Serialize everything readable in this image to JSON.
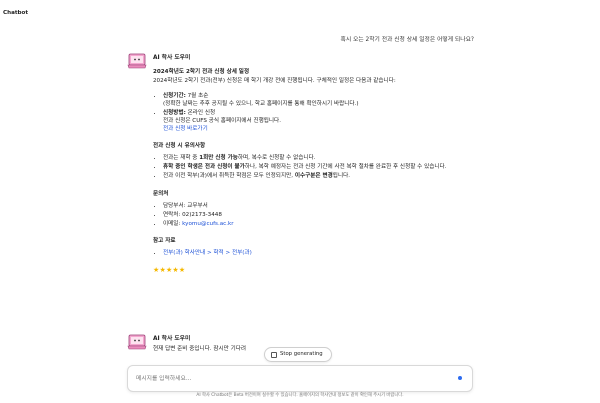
{
  "app": {
    "title": "Chatbot"
  },
  "user_message": "혹시 오는 2학기 전과 신청 상세 일정은 어떻게 되나요?",
  "bot_name": "AI 학사 도우미",
  "answer": {
    "heading": "2024학년도 2학기 전과 신청 상세 일정",
    "intro": "2024학년도 2학기 전과(전부) 신청은 매 학기 개강 전에 진행됩니다. 구체적인 일정은 다음과 같습니다:",
    "period_label": "신청기간:",
    "period_value": "7월 초순",
    "period_note": "(정확한 날짜는 추후 공지될 수 있으니, 학교 홈페이지를 통해 확인하시기 바랍니다.)",
    "method_label": "신청방법:",
    "method_value": "온라인 신청",
    "method_note": "전과 신청은 CUFS 공식 홈페이지에서 진행됩니다.",
    "method_link": "전과 신청 바로가기",
    "caution_title": "전과 신청 시 유의사항",
    "caution_1_pre": "전과는 재학 중 ",
    "caution_1_bold": "1회만 신청 가능",
    "caution_1_post": "하며, 복수로 신청할 수 없습니다.",
    "caution_2_bold": "휴학 중인 학생은 전과 신청이 불가",
    "caution_2_post": "하나, 복학 예정자는 전과 신청 기간에 사전 복학 절차를 완료한 후 신청할 수 있습니다.",
    "caution_3_pre": "전과 이전 학부(과)에서 취득한 학점은 모두 인정되지만, ",
    "caution_3_bold": "이수구분은 변경",
    "caution_3_post": "됩니다.",
    "contact_title": "문의처",
    "contact_dept": "담당부서: 교무부서",
    "contact_phone": "연락처: 02)2173-3448",
    "contact_email_label": "이메일: ",
    "contact_email": "kyomu@cufs.ac.kr",
    "ref_title": "참고 자료",
    "ref_link": "전부(과) 학사안내 > 학적 > 전부(과)",
    "stars": "★★★★★"
  },
  "pending": {
    "bot_name": "AI 학사 도우미",
    "text": "현재 답변 준비 중입니다. 잠시만 기다려"
  },
  "stop_button": "Stop generating",
  "input": {
    "placeholder": "메시지를 입력하세요..."
  },
  "disclaimer": "AI 학사 Chatbot은 Beta 버전이며 실수할 수 있습니다. 홈페이지의 학사안내 정보도 같이 확인해 주시기 바랍니다.",
  "colors": {
    "link": "#1a4fd6",
    "stars": "#f5b800",
    "send": "#2d6cf0"
  },
  "icons": {
    "avatar": "pink-laptop-robot-icon",
    "stop": "stop-square-icon",
    "send": "send-dot-icon"
  }
}
